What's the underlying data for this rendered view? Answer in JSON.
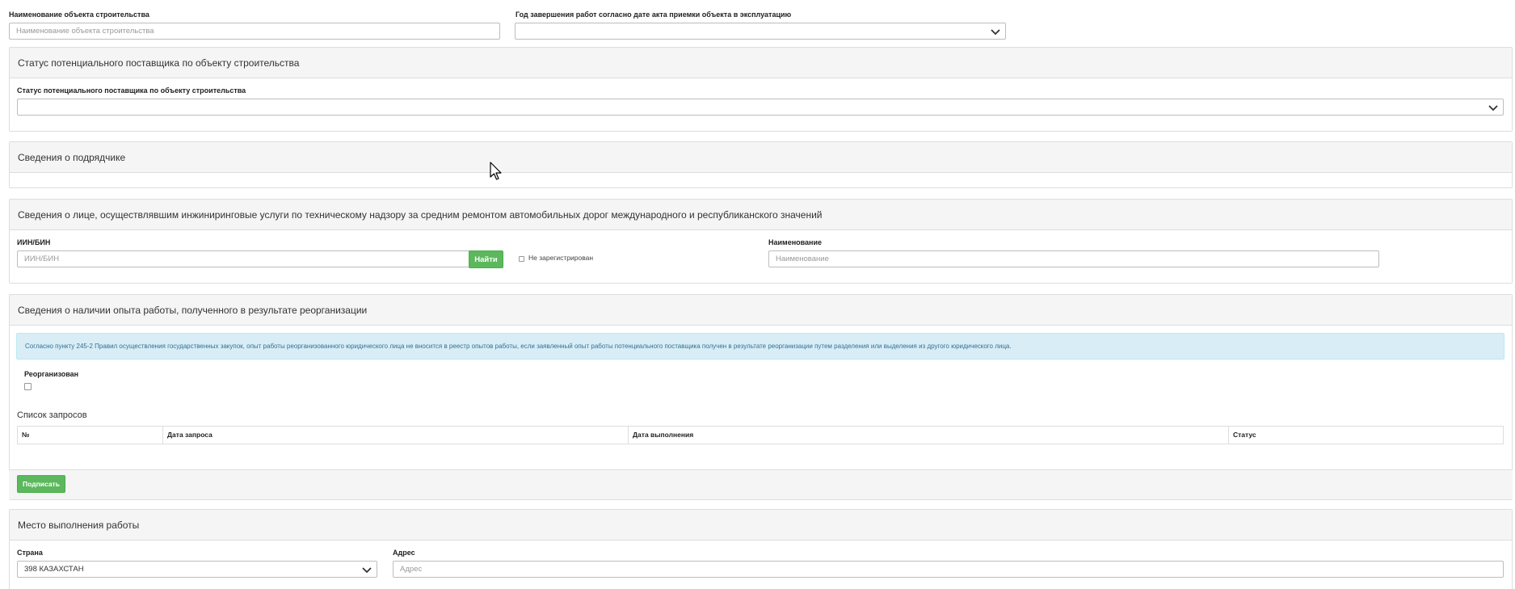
{
  "top": {
    "object_name_label": "Наименование объекта строительства",
    "object_name_placeholder": "Наименование объекта строительства",
    "year_label": "Год завершения работ согласно дате акта приемки объекта в эксплуатацию",
    "year_value": ""
  },
  "status_panel": {
    "title": "Статус потенциального поставщика по объекту строительства",
    "field_label": "Статус потенциального поставщика по объекту строительства",
    "field_value": ""
  },
  "contractor_panel": {
    "title": "Сведения о подрядчике"
  },
  "engineering_panel": {
    "title": "Сведения о лице, осуществлявшим инжиниринговые услуги по техническому надзору за средним ремонтом автомобильных дорог международного и республиканского значений",
    "iin_label": "ИИН/БИН",
    "iin_placeholder": "ИИН/БИН",
    "find_button": "Найти",
    "not_registered_label": "Не зарегистрирован",
    "name_label": "Наименование",
    "name_placeholder": "Наименование"
  },
  "reorg_panel": {
    "title": "Сведения о наличии опыта работы, полученного в результате реорганизации",
    "notice": "Согласно пункту 245-2 Правил осуществления государственных закупок, опыт работы реорганизованного юридического лица не вносится в реестр опытов работы, если заявленный опыт работы потенциального поставщика получен в результате реорганизации путем разделения или выделения из другого юридического лица.",
    "reorganized_label": "Реорганизован",
    "requests_title": "Список запросов",
    "columns": [
      "№",
      "Дата запроса",
      "Дата выполнения",
      "Статус"
    ],
    "sign_button": "Подписать"
  },
  "place_panel": {
    "title": "Место выполнения работы",
    "country_label": "Страна",
    "country_value": "398 КАЗАХСТАН",
    "address_label": "Адрес",
    "address_placeholder": "Адрес"
  }
}
